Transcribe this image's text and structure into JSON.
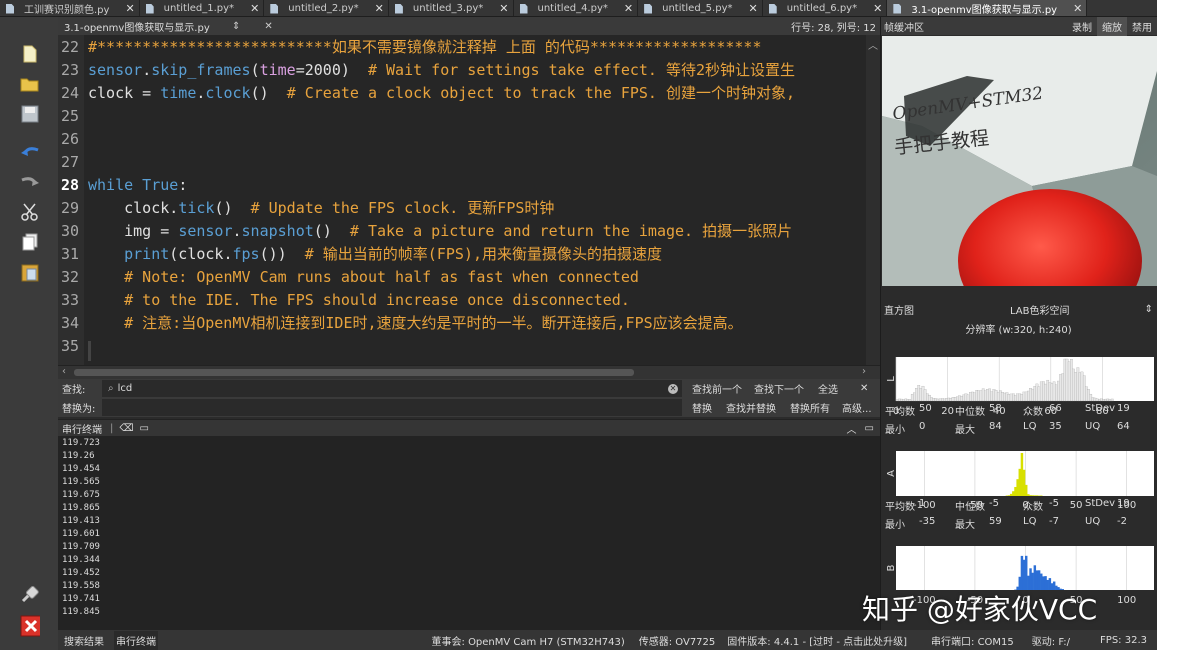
{
  "tabs": [
    {
      "label": "工训赛识别颜色.py",
      "active": false
    },
    {
      "label": "untitled_1.py*",
      "active": false
    },
    {
      "label": "untitled_2.py*",
      "active": false
    },
    {
      "label": "untitled_3.py*",
      "active": false
    },
    {
      "label": "untitled_4.py*",
      "active": false
    },
    {
      "label": "untitled_5.py*",
      "active": false
    },
    {
      "label": "untitled_6.py*",
      "active": false
    },
    {
      "label": "3.1-openmv图像获取与显示.py",
      "active": true
    }
  ],
  "editor_header": {
    "file": "3.1-openmv图像获取与显示.py",
    "position": "行号: 28, 列号: 12"
  },
  "code_lines": [
    {
      "n": "22",
      "parts": [
        [
          "c-cmt",
          "#**************************如果不需要镜像就注释掉 上面 的代码*******************"
        ]
      ]
    },
    {
      "n": "23",
      "parts": [
        [
          "c-fn",
          "sensor"
        ],
        [
          "c-txt",
          "."
        ],
        [
          "c-fn",
          "skip_frames"
        ],
        [
          "c-txt",
          "("
        ],
        [
          "c-par",
          "time"
        ],
        [
          "c-txt",
          "=2000)  "
        ],
        [
          "c-cmt",
          "# Wait for settings take effect. 等待2秒钟让设置生"
        ]
      ]
    },
    {
      "n": "24",
      "parts": [
        [
          "c-txt",
          "clock = "
        ],
        [
          "c-fn",
          "time"
        ],
        [
          "c-txt",
          "."
        ],
        [
          "c-fn",
          "clock"
        ],
        [
          "c-txt",
          "()  "
        ],
        [
          "c-cmt",
          "# Create a clock object to track the FPS. 创建一个时钟对象,"
        ]
      ]
    },
    {
      "n": "25",
      "parts": []
    },
    {
      "n": "26",
      "parts": []
    },
    {
      "n": "27",
      "parts": []
    },
    {
      "n": "28",
      "parts": [
        [
          "c-kw",
          "while True"
        ],
        [
          "c-txt",
          ":"
        ]
      ],
      "hi": true
    },
    {
      "n": "29",
      "parts": [
        [
          "c-txt",
          "    clock."
        ],
        [
          "c-fn",
          "tick"
        ],
        [
          "c-txt",
          "()  "
        ],
        [
          "c-cmt",
          "# Update the FPS clock. 更新FPS时钟"
        ]
      ]
    },
    {
      "n": "30",
      "parts": [
        [
          "c-txt",
          "    img = "
        ],
        [
          "c-fn",
          "sensor"
        ],
        [
          "c-txt",
          "."
        ],
        [
          "c-fn",
          "snapshot"
        ],
        [
          "c-txt",
          "()  "
        ],
        [
          "c-cmt",
          "# Take a picture and return the image. 拍摄一张照片"
        ]
      ]
    },
    {
      "n": "31",
      "parts": [
        [
          "c-txt",
          "    "
        ],
        [
          "c-fn",
          "print"
        ],
        [
          "c-txt",
          "(clock."
        ],
        [
          "c-fn",
          "fps"
        ],
        [
          "c-txt",
          "())  "
        ],
        [
          "c-cmt",
          "# 输出当前的帧率(FPS),用来衡量摄像头的拍摄速度"
        ]
      ]
    },
    {
      "n": "32",
      "parts": [
        [
          "c-cmt",
          "    # Note: OpenMV Cam runs about half as fast when connected"
        ]
      ]
    },
    {
      "n": "33",
      "parts": [
        [
          "c-cmt",
          "    # to the IDE. The FPS should increase once disconnected."
        ]
      ]
    },
    {
      "n": "34",
      "parts": [
        [
          "c-cmt",
          "    # 注意:当OpenMV相机连接到IDE时,速度大约是平时的一半。断开连接后,FPS应该会提高。"
        ]
      ]
    },
    {
      "n": "35",
      "parts": []
    }
  ],
  "find": {
    "find_label": "查找:",
    "find_value": "lcd",
    "replace_label": "替换为:",
    "find_prev": "查找前一个",
    "find_next": "查找下一个",
    "all": "全选",
    "replace": "替换",
    "find_replace": "查找并替换",
    "replace_all": "替换所有",
    "advanced": "高级..."
  },
  "serial": {
    "title": "串行终端",
    "lines": [
      "119.723",
      "119.26",
      "119.454",
      "119.565",
      "119.675",
      "119.865",
      "119.413",
      "119.601",
      "119.709",
      "119.344",
      "119.452",
      "119.558",
      "119.741",
      "119.845"
    ]
  },
  "status": {
    "tab_search": "搜索结果",
    "tab_serial": "串行终端",
    "board": "董事会: OpenMV Cam H7 (STM32H743)",
    "sensor": "传感器: OV7725",
    "firmware": "固件版本: 4.4.1 - [过时 - 点击此处升级]",
    "port": "串行端口: COM15",
    "drive": "驱动: F:/",
    "fps": "FPS: 32.3"
  },
  "framebuffer": {
    "title": "帧缓冲区",
    "record": "录制",
    "zoom": "缩放",
    "disable": "禁用",
    "card_line1": "OpenMV+STM32",
    "card_line2": "手把手教程"
  },
  "histogram": {
    "title": "直方图",
    "colorspace": "LAB色彩空间",
    "resolution": "分辨率 (w:320, h:240)",
    "channels": [
      {
        "label": "L",
        "color": "#e8e8e8",
        "ticks": [
          "0",
          "20",
          "40",
          "60",
          "80"
        ],
        "tick_values": [
          0,
          20,
          40,
          60,
          80
        ],
        "range": [
          0,
          100
        ],
        "stats": {
          "mean_label": "平均数",
          "mean": "50",
          "median_label": "中位数",
          "median": "58",
          "mode_label": "众数",
          "mode": "66",
          "stdev_label": "StDev",
          "stdev": "19",
          "min_label": "最小",
          "min": "0",
          "max_label": "最大",
          "max": "84",
          "lq_label": "LQ",
          "lq": "35",
          "uq_label": "UQ",
          "uq": "64"
        }
      },
      {
        "label": "A",
        "color": "#d8e000",
        "ticks": [
          "-100",
          "-50",
          "0",
          "50",
          "100"
        ],
        "tick_values": [
          -100,
          -50,
          0,
          50,
          100
        ],
        "range": [
          -128,
          127
        ],
        "stats": {
          "mean_label": "平均数",
          "mean": "1",
          "median_label": "中位数",
          "median": "-5",
          "mode_label": "众数",
          "mode": "-5",
          "stdev_label": "StDev",
          "stdev": "19",
          "min_label": "最小",
          "min": "-35",
          "max_label": "最大",
          "max": "59",
          "lq_label": "LQ",
          "lq": "-7",
          "uq_label": "UQ",
          "uq": "-2"
        }
      },
      {
        "label": "B",
        "color": "#2c6fd6",
        "ticks": [
          "-100",
          "-50",
          "0",
          "50",
          "100"
        ],
        "tick_values": [
          -100,
          -50,
          0,
          50,
          100
        ],
        "range": [
          -128,
          127
        ]
      }
    ]
  },
  "watermark": "知乎 @好家伙VCC"
}
